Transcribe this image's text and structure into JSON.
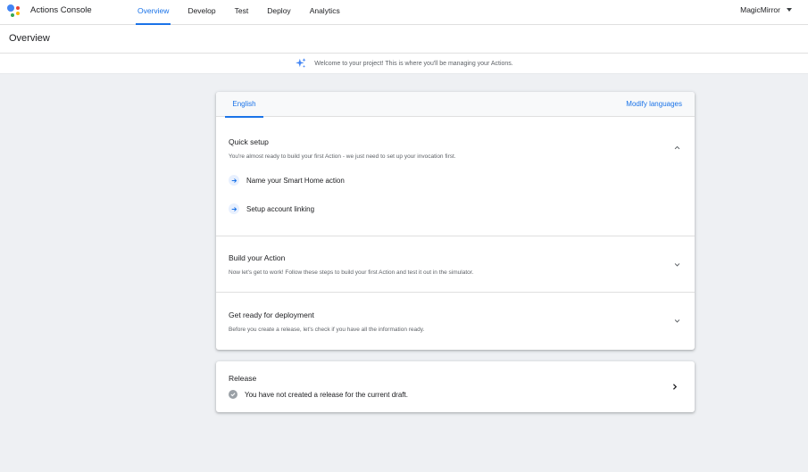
{
  "header": {
    "app_name": "Actions Console",
    "nav_tabs": [
      {
        "label": "Overview",
        "active": true
      },
      {
        "label": "Develop"
      },
      {
        "label": "Test"
      },
      {
        "label": "Deploy"
      },
      {
        "label": "Analytics"
      }
    ],
    "project_name": "MagicMirror"
  },
  "page": {
    "title": "Overview",
    "banner_text": "Welcome to your project! This is where you'll be managing your Actions.",
    "banner_icon": "sparkle-icon"
  },
  "main_card": {
    "language_tab": "English",
    "modify_languages": "Modify languages",
    "quick_setup": {
      "title": "Quick setup",
      "description": "You're almost ready to build your first Action - we just need to set up your invocation first.",
      "steps": [
        {
          "label": "Name your Smart Home action",
          "icon": "arrow-right-icon"
        },
        {
          "label": "Setup account linking",
          "icon": "arrow-right-icon"
        }
      ]
    },
    "build": {
      "title": "Build your Action",
      "description": "Now let's get to work! Follow these steps to build your first Action and test it out in the simulator."
    },
    "deployment": {
      "title": "Get ready for deployment",
      "description": "Before you create a release, let's check if you have all the information ready."
    }
  },
  "release_card": {
    "title": "Release",
    "status": "You have not created a release for the current draft."
  },
  "colors": {
    "accent": "#1a73e8",
    "background": "#eef0f3",
    "step_icon_bg": "#e8f0fe",
    "status_icon": "#9aa0a6"
  }
}
